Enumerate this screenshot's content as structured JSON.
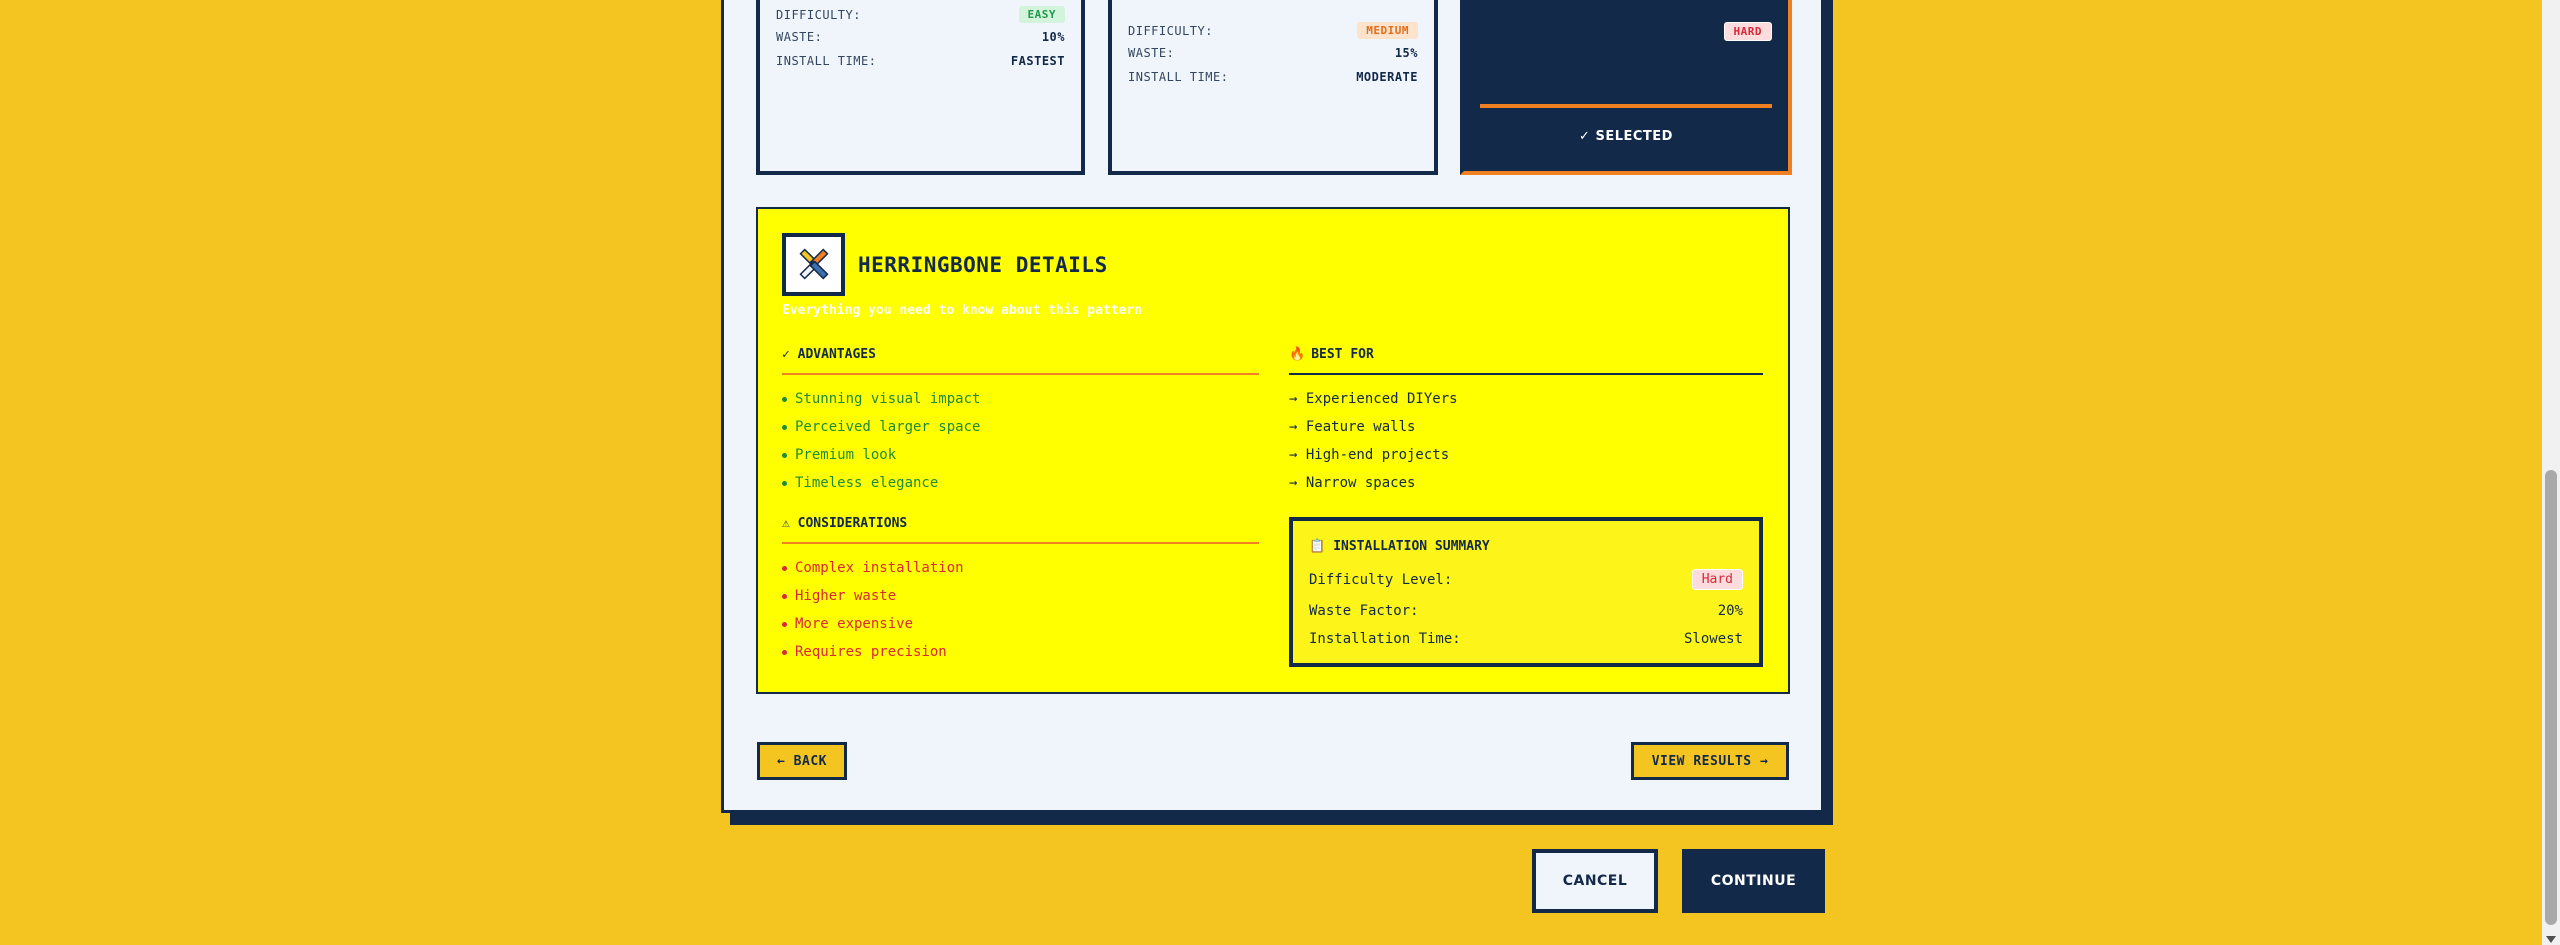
{
  "cards": [
    {
      "difficulty_label": "DIFFICULTY:",
      "difficulty": "EASY",
      "waste_label": "WASTE:",
      "waste": "10%",
      "install_label": "INSTALL TIME:",
      "install": "FASTEST"
    },
    {
      "difficulty_label": "DIFFICULTY:",
      "difficulty": "MEDIUM",
      "waste_label": "WASTE:",
      "waste": "15%",
      "install_label": "INSTALL TIME:",
      "install": "MODERATE"
    },
    {
      "difficulty": "HARD",
      "selected_label": "✓ SELECTED"
    }
  ],
  "details": {
    "icon": "herringbone-pattern-icon",
    "title": "HERRINGBONE DETAILS",
    "subtitle": "Everything you need to know about this pattern",
    "advantages": {
      "heading": "✓ ADVANTAGES",
      "items": [
        "Stunning visual impact",
        "Perceived larger space",
        "Premium look",
        "Timeless elegance"
      ]
    },
    "considerations": {
      "heading": "⚠ CONSIDERATIONS",
      "items": [
        "Complex installation",
        "Higher waste",
        "More expensive",
        "Requires precision"
      ]
    },
    "best_for": {
      "heading": "BEST FOR",
      "icon": "fire-icon",
      "items": [
        "→ Experienced DIYers",
        "→ Feature walls",
        "→ High-end projects",
        "→ Narrow spaces"
      ]
    },
    "summary": {
      "heading": "INSTALLATION SUMMARY",
      "icon": "clipboard-icon",
      "difficulty_label": "Difficulty Level:",
      "difficulty": "Hard",
      "waste_label": "Waste Factor:",
      "waste": "20%",
      "time_label": "Installation Time:",
      "time": "Slowest"
    }
  },
  "nav": {
    "back": "← BACK",
    "results": "VIEW RESULTS →"
  },
  "footer": {
    "cancel": "CANCEL",
    "continue": "CONTINUE"
  },
  "colors": {
    "background": "#F4C520",
    "navy": "#12294A",
    "highlight": "#FFFF00",
    "accent": "#F08020"
  }
}
